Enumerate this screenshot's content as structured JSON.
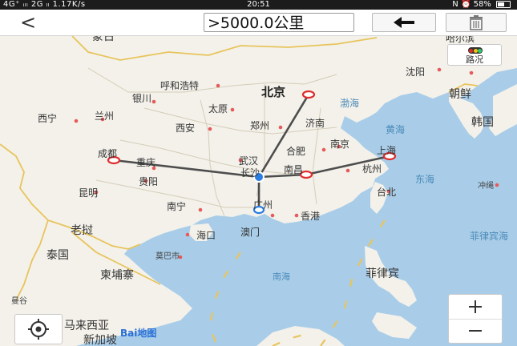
{
  "status_bar": {
    "left": "4G⁺ ᵢₗₗ 2G ₗₗ 1.17K/s",
    "time": "20:51",
    "right": "N ⏰ 58%"
  },
  "header": {
    "back_label": "<",
    "distance_label": ">5000.0公里",
    "undo_icon": "arrow-left-icon",
    "clear_icon": "trash-icon"
  },
  "map": {
    "traffic_label": "路况",
    "baidu_logo": "Bai地图",
    "labels": {
      "mongolia": "蒙古",
      "harbin": "哈尔滨",
      "hohhot": "呼和浩特",
      "shenyang": "沈阳",
      "yinchuan": "银川",
      "beijing": "北京",
      "north_korea": "朝鲜",
      "taiyuan": "太原",
      "bohai": "渤海",
      "xining": "西宁",
      "lanzhou": "兰州",
      "korea": "韩国",
      "zhengzhou": "郑州",
      "jinan": "济南",
      "xian": "西安",
      "yellow_sea": "黄海",
      "nanjing": "南京",
      "chengdu": "成都",
      "hefei": "合肥",
      "shanghai": "上海",
      "chongqing": "重庆",
      "wuhan": "武汉",
      "east_sea": "东海",
      "changsha": "长沙",
      "nanchang": "南昌",
      "hangzhou": "杭州",
      "guiyang": "贵阳",
      "okinawa": "冲绳",
      "kunming": "昆明",
      "taipei": "台北",
      "nanning": "南宁",
      "guangzhou": "广州",
      "hongkong": "香港",
      "laos": "老挝",
      "haikou": "海口",
      "macau": "澳门",
      "philippine_sea": "菲律宾海",
      "thailand": "泰国",
      "mobai": "莫巴市",
      "cambodia": "柬埔寨",
      "south_sea": "南海",
      "philippines": "菲律宾",
      "malaysia": "马来西亚",
      "singapore": "新加坡",
      "bangkok": "曼谷"
    }
  },
  "colors": {
    "land": "#f3f1ea",
    "water": "#a9cde8",
    "route": "#4d4d4d",
    "marker_red": "#e02b2b",
    "marker_blue": "#2a7de1",
    "border_yellow": "#e8c45c"
  }
}
